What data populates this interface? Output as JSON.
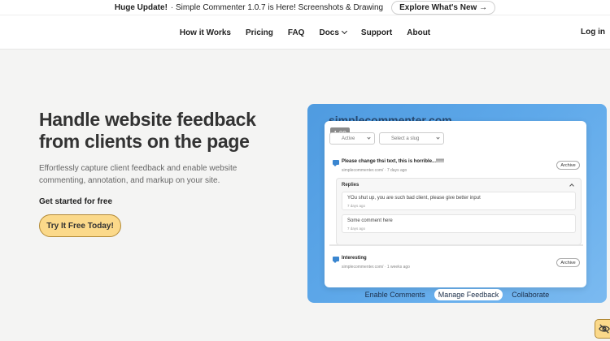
{
  "announcement": {
    "strong": "Huge Update!",
    "message": "· Simple Commenter 1.0.7 is Here! Screenshots & Drawing",
    "cta": "Explore What's New →"
  },
  "nav": {
    "items": [
      "How it Works",
      "Pricing",
      "FAQ",
      "Docs",
      "Support",
      "About"
    ],
    "login": "Log in"
  },
  "hero": {
    "title": "Handle website feedback from clients on the page",
    "subtitle": "Effortlessly capture client feedback and enable website commenting, annotation, and markup on your site.",
    "get_started": "Get started for free",
    "cta": "Try It Free Today!"
  },
  "showcase": {
    "brand": "simplecommenter.com",
    "version": "1.00",
    "filter_status": "Active",
    "filter_slug_placeholder": "Select a slug",
    "comments": [
      {
        "text": "Please change thsi text, this is horrible...!!!!!",
        "meta": "simplecommenter.com/ · 7 days ago",
        "action": "Archive"
      },
      {
        "text": "Interesting",
        "meta": "simplecommenter.com/ · 1 weeks ago",
        "action": "Archive"
      }
    ],
    "replies_label": "Replies",
    "replies": [
      {
        "text": "YOu shut up, you are such bad client, please give better input",
        "meta": "7 days ago"
      },
      {
        "text": "Some comment here",
        "meta": "7 days ago"
      }
    ],
    "tabs": [
      "Enable Comments",
      "Manage Feedback",
      "Collaborate"
    ],
    "active_tab": "Manage Feedback"
  },
  "colors": {
    "accent_yellow": "#fbd98a",
    "showcase_blue": "#5fa9ea",
    "comment_icon_blue": "#3a86d0"
  }
}
